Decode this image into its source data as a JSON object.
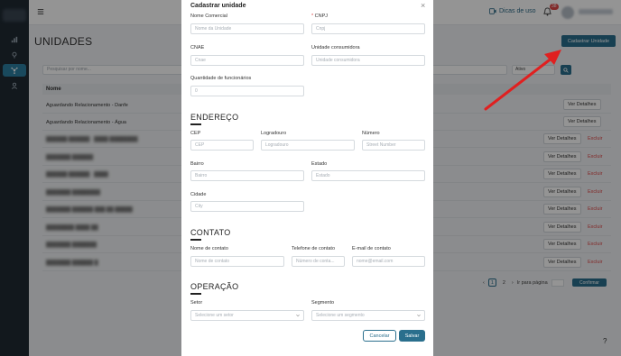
{
  "topbar": {
    "dicas_label": "Dicas de uso",
    "notification_count": "38"
  },
  "page": {
    "title": "UNIDADES",
    "cadastrar_label": "Cadastrar Unidade",
    "search_placeholder": "Pesquisar por nome...",
    "status_value": "Ativo",
    "table_header": "Nome",
    "details_label": "Ver Detalhes",
    "excluir_label": "Excluir",
    "rows": [
      "Aguardando Relacionamento - Danfe",
      "Aguardando Relacionamento - Água"
    ],
    "pagination": {
      "page1": "1",
      "page2": "2",
      "goto_label": "Ir para página",
      "confirm_label": "Confirmar"
    },
    "help": "?"
  },
  "modal": {
    "title": "Cadastrar unidade",
    "close": "×",
    "fields": {
      "nome_comercial": {
        "label": "Nome Comercial",
        "placeholder": "Nome da Unidade"
      },
      "cnpj": {
        "label": "CNPJ",
        "required": "*",
        "placeholder": "Cnpj"
      },
      "cnae": {
        "label": "CNAE",
        "placeholder": "Cnae"
      },
      "unidade_consumidora": {
        "label": "Unidade consumidora",
        "placeholder": "Unidade consumidora"
      },
      "qtd_funcionarios": {
        "label": "Quantidade de funcionários",
        "placeholder": "0"
      }
    },
    "endereco": {
      "title": "ENDEREÇO",
      "cep": {
        "label": "CEP",
        "placeholder": "CEP"
      },
      "logradouro": {
        "label": "Logradouro",
        "placeholder": "Logradouro"
      },
      "numero": {
        "label": "Número",
        "placeholder": "Street Number"
      },
      "bairro": {
        "label": "Bairro",
        "placeholder": "Bairro"
      },
      "estado": {
        "label": "Estado",
        "placeholder": "Estado"
      },
      "cidade": {
        "label": "Cidade",
        "placeholder": "City"
      }
    },
    "contato": {
      "title": "CONTATO",
      "nome": {
        "label": "Nome de contato",
        "placeholder": "Nome de contato"
      },
      "telefone": {
        "label": "Telefone de contato",
        "placeholder": "Número de conta..."
      },
      "email": {
        "label": "E-mail de contato",
        "placeholder": "nome@email.com"
      }
    },
    "operacao": {
      "title": "OPERAÇÃO",
      "setor": {
        "label": "Setor",
        "placeholder": "Selecione um setor"
      },
      "segmento": {
        "label": "Segmento",
        "placeholder": "Selecione um segmento"
      }
    },
    "cancel_label": "Cancelar",
    "save_label": "Salvar"
  },
  "colors": {
    "accent": "#2a6f8d",
    "danger": "#e04848",
    "annotation_arrow": "#e02020"
  }
}
